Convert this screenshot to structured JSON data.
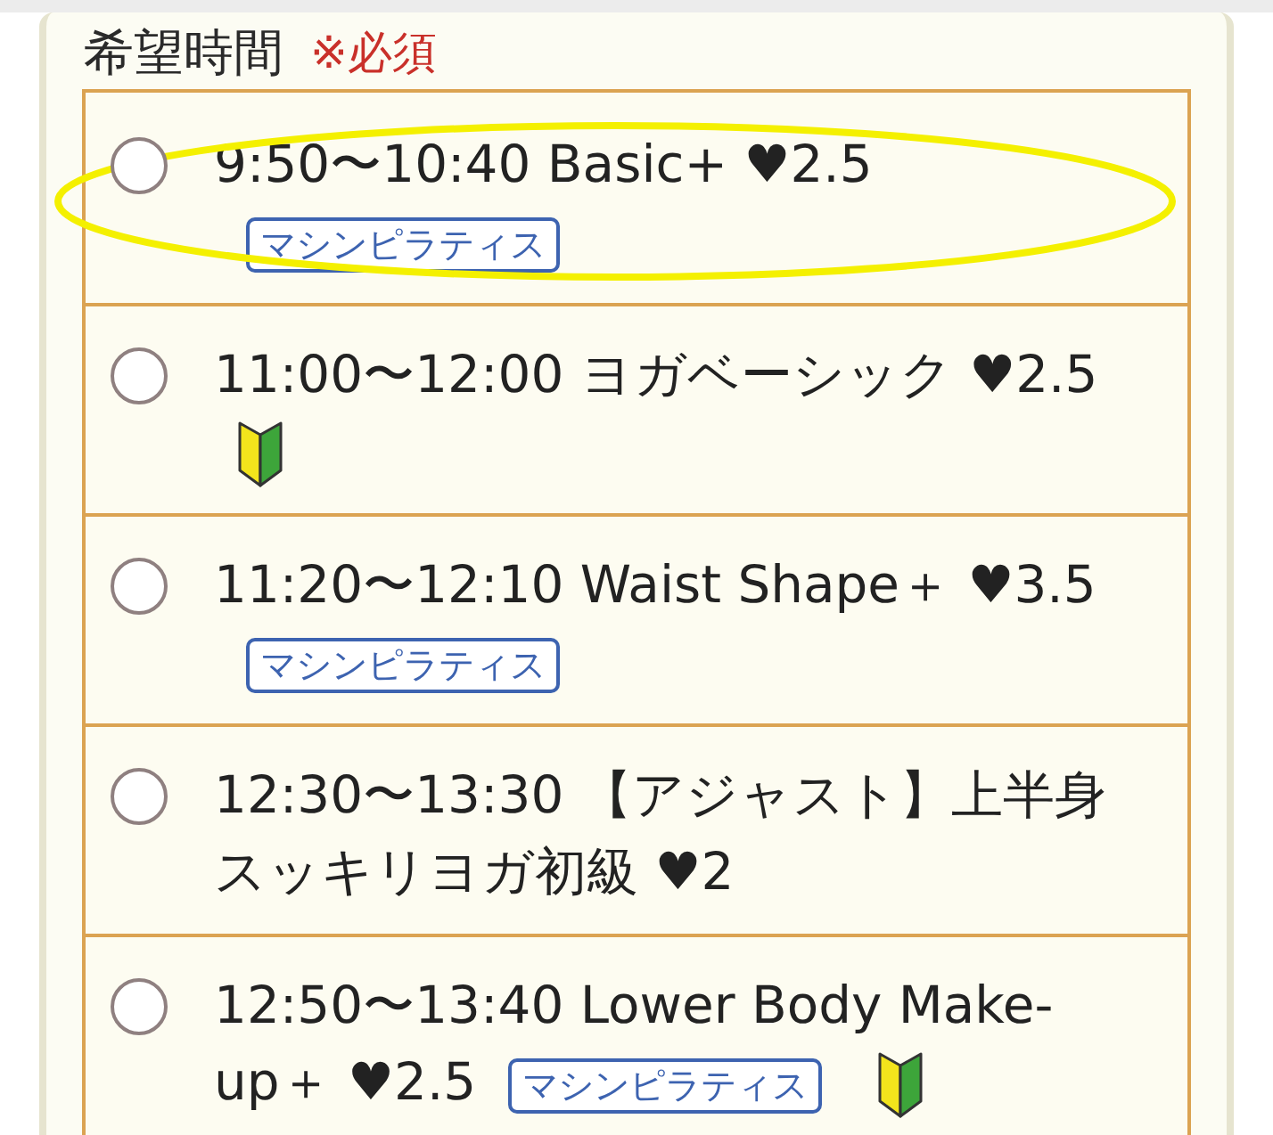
{
  "field": {
    "label": "希望時間",
    "required_mark": "※必須"
  },
  "options": [
    {
      "label": "9:50〜10:40 Basic+ ♥2.5",
      "tags": [
        "マシンピラティス"
      ],
      "beginner": false,
      "selected": false,
      "circled": true
    },
    {
      "label": "11:00〜12:00 ヨガベーシック ♥2.5",
      "beginner": true,
      "selected": false,
      "circled": false
    },
    {
      "label": "11:20〜12:10 Waist Shape＋ ♥3.5",
      "tags": [
        "マシンピラティス"
      ],
      "beginner": false,
      "selected": false,
      "circled": false
    },
    {
      "label": "12:30〜13:30 【アジャスト】上半身スッキリヨガ初級 ♥2",
      "beginner": false,
      "selected": false,
      "circled": false
    },
    {
      "label": "12:50〜13:40 Lower Body Make-up＋ ♥2.5",
      "tags": [
        "マシンピラティス"
      ],
      "beginner": true,
      "selected": false,
      "circled": false
    }
  ]
}
